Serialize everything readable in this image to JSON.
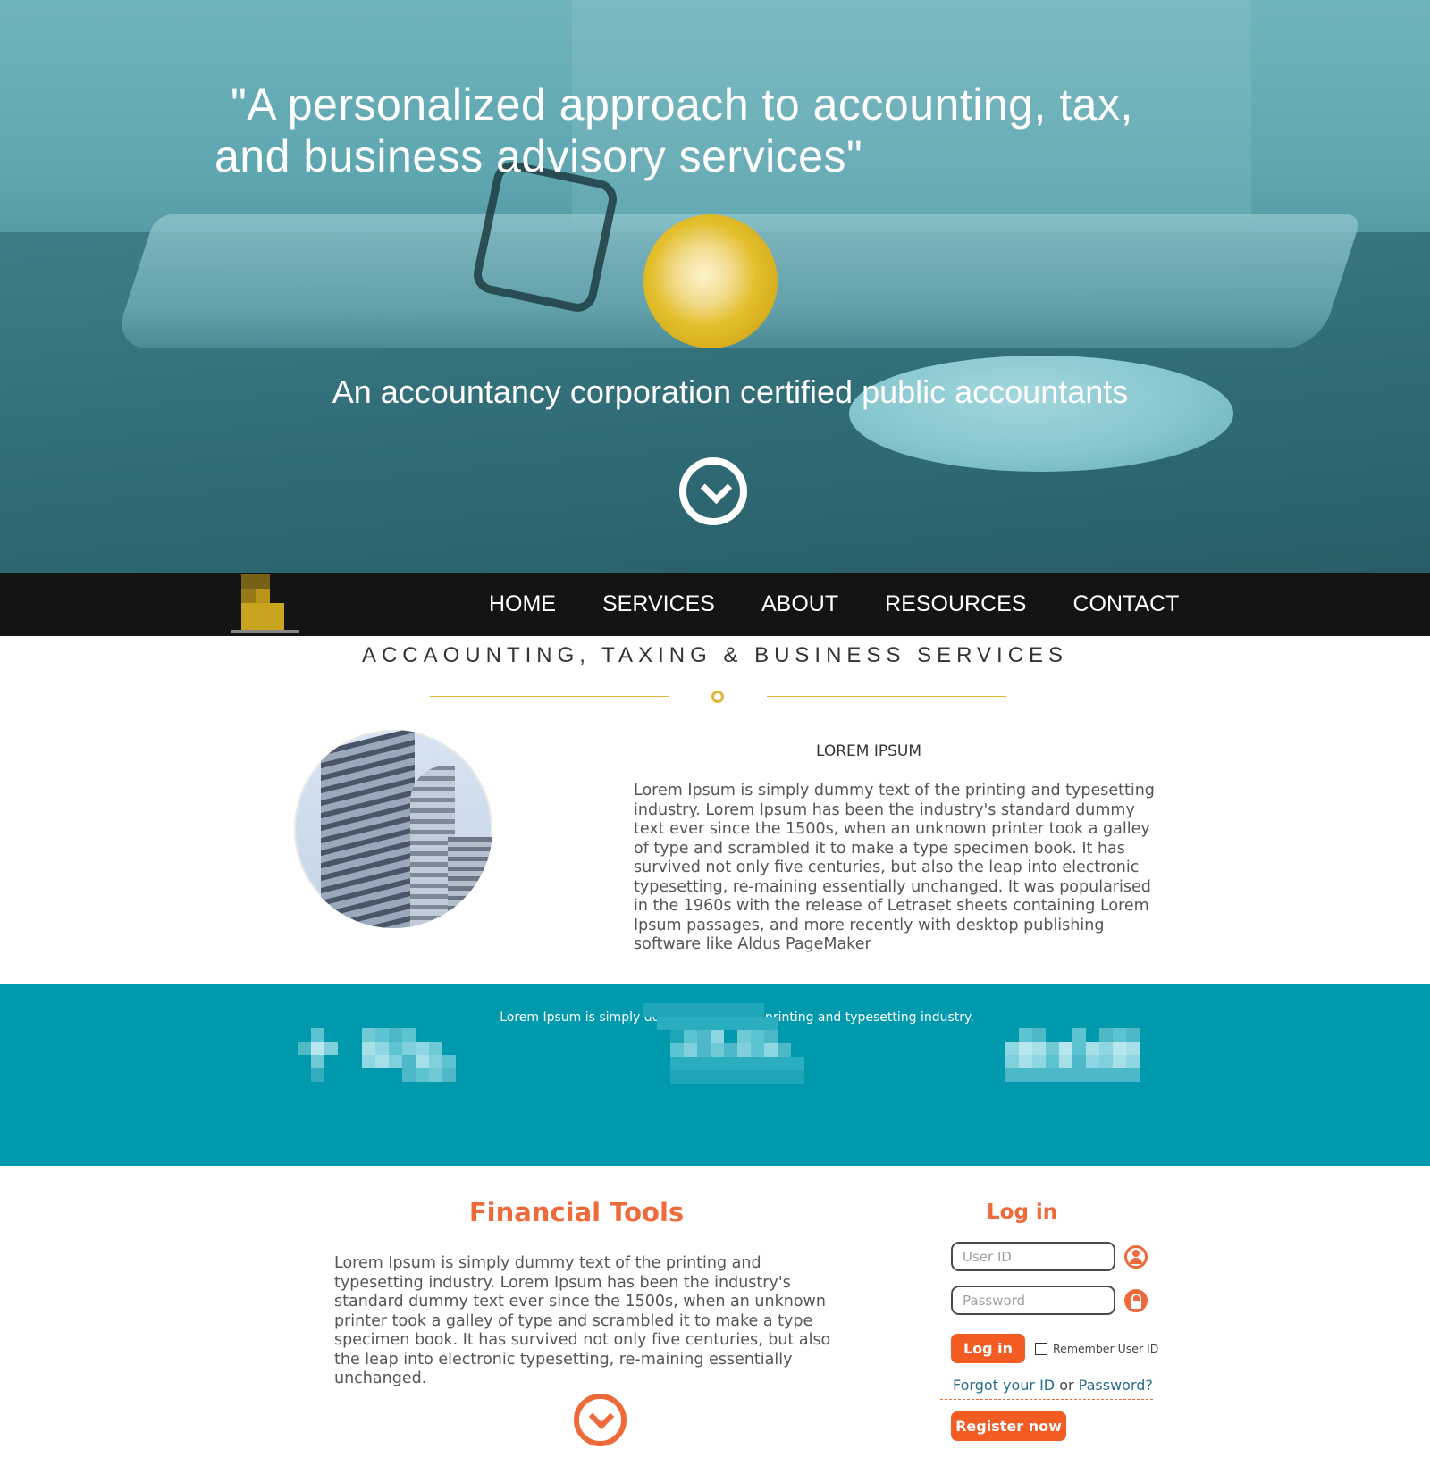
{
  "hero": {
    "quote_line1": "\"A personalized approach to accounting, tax,",
    "quote_line2": "and business advisory services\"",
    "subtitle": "An accountancy corporation certified public accountants",
    "scroll_icon": "chevron-down-circle-icon"
  },
  "nav": {
    "items": [
      "HOME",
      "SERVICES",
      "ABOUT",
      "RESOURCES",
      "CONTACT"
    ]
  },
  "section": {
    "title": "ACCAOUNTING, TAXING & BUSINESS SERVICES"
  },
  "about": {
    "title": "LOREM IPSUM",
    "text": "Lorem Ipsum is simply dummy text of the printing and typesetting industry. Lorem Ipsum has been the industry's standard dummy text ever since the 1500s, when an unknown printer took a galley of type and scrambled it to make a type specimen book. It has survived not only five centuries, but also the leap into electronic typesetting, re-maining essentially unchanged. It was popularised in the 1960s with the release of Letraset sheets containing Lorem Ipsum passages, and more recently with desktop publishing software like Aldus PageMaker"
  },
  "band": {
    "text": "Lorem Ipsum is simply dummy text of the printing and typesetting industry."
  },
  "financial_tools": {
    "title": "Financial Tools",
    "text": "Lorem Ipsum is simply dummy text of the printing and typesetting industry. Lorem Ipsum has been the industry's standard dummy text ever since the 1500s, when an unknown printer took a galley of type and scrambled it to make a type specimen book. It has survived not only five centuries, but also the leap into electronic typesetting, re-maining essentially unchanged."
  },
  "login": {
    "title": "Log in",
    "user_placeholder": "User ID",
    "password_placeholder": "Password",
    "button": "Log in",
    "remember_label": "Remember User ID",
    "forgot_id": "Forgot your ID",
    "or": " or ",
    "forgot_password": "Password?",
    "register": "Register now"
  },
  "colors": {
    "accent_orange": "#ef6a3a",
    "teal": "#0099ae",
    "gold": "#e2b53a",
    "nav_bg": "#141414"
  }
}
